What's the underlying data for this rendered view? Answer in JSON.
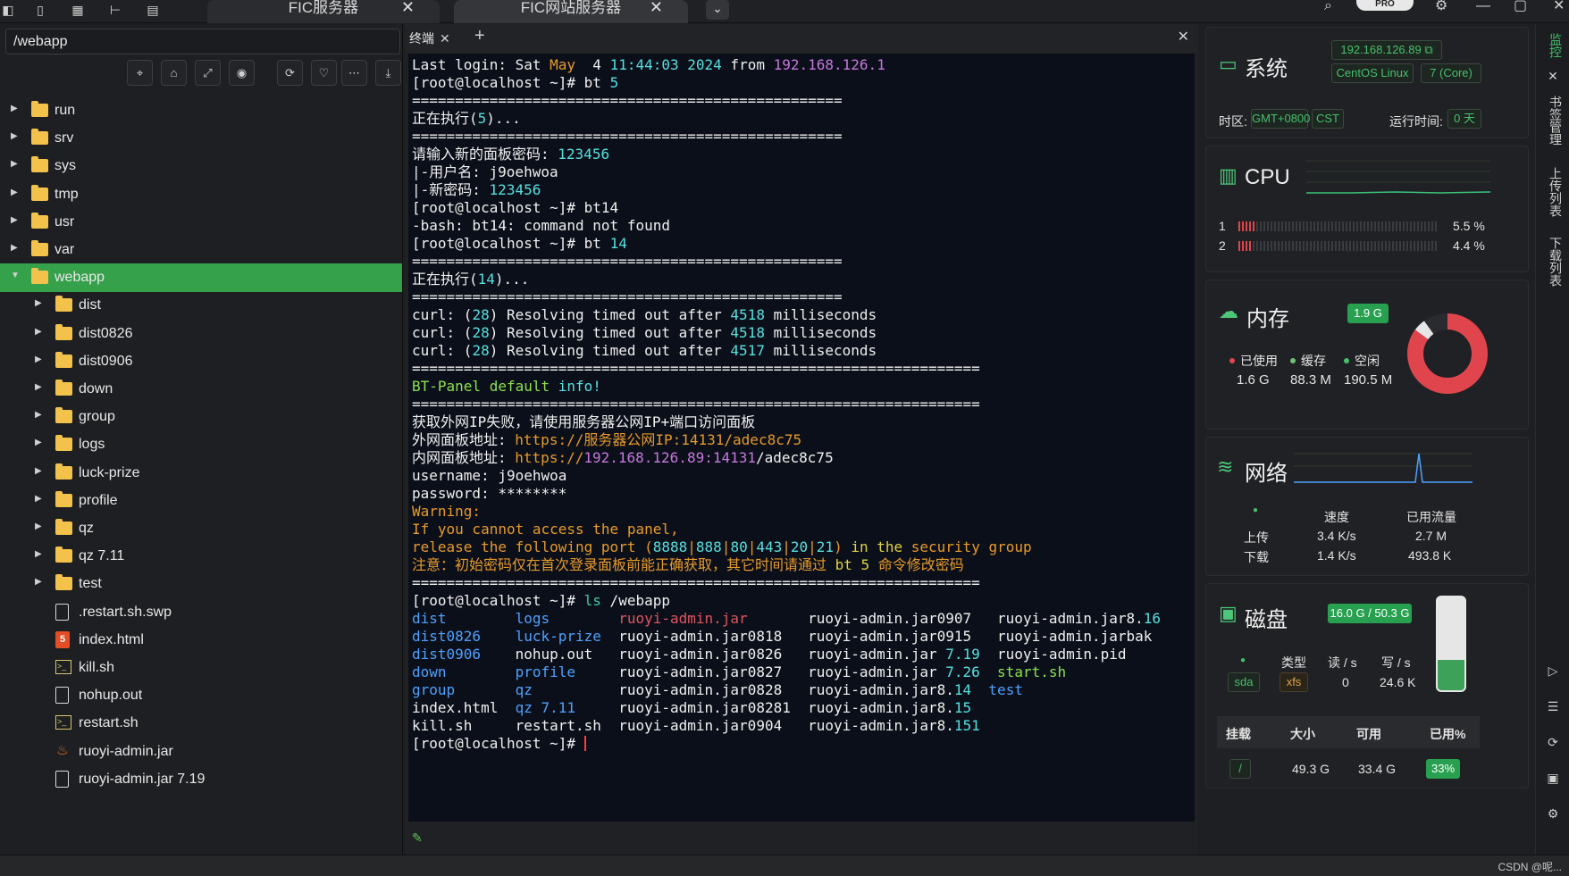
{
  "tabs": [
    {
      "label": "FIC服务器",
      "close": "✕"
    },
    {
      "label": "FIC网站服务器",
      "close": "✕"
    }
  ],
  "tab_dropdown": "⌄",
  "file_panel": {
    "path": "/webapp",
    "toolbar": [
      "⌖",
      "⌂",
      "⤢",
      "◉",
      "⟳",
      "♡",
      "⋯",
      "⤓"
    ],
    "items": [
      {
        "name": "run",
        "type": "folder",
        "indent": 0
      },
      {
        "name": "srv",
        "type": "folder",
        "indent": 0
      },
      {
        "name": "sys",
        "type": "folder",
        "indent": 0
      },
      {
        "name": "tmp",
        "type": "folder",
        "indent": 0
      },
      {
        "name": "usr",
        "type": "folder",
        "indent": 0
      },
      {
        "name": "var",
        "type": "folder",
        "indent": 0
      },
      {
        "name": "webapp",
        "type": "folder",
        "indent": 0,
        "expanded": true,
        "selected": true
      },
      {
        "name": "dist",
        "type": "folder",
        "indent": 1
      },
      {
        "name": "dist0826",
        "type": "folder",
        "indent": 1
      },
      {
        "name": "dist0906",
        "type": "folder",
        "indent": 1
      },
      {
        "name": "down",
        "type": "folder",
        "indent": 1
      },
      {
        "name": "group",
        "type": "folder",
        "indent": 1
      },
      {
        "name": "logs",
        "type": "folder",
        "indent": 1
      },
      {
        "name": "luck-prize",
        "type": "folder",
        "indent": 1
      },
      {
        "name": "profile",
        "type": "folder",
        "indent": 1
      },
      {
        "name": "qz",
        "type": "folder",
        "indent": 1
      },
      {
        "name": "qz 7.11",
        "type": "folder",
        "indent": 1
      },
      {
        "name": "test",
        "type": "folder",
        "indent": 1
      },
      {
        "name": ".restart.sh.swp",
        "type": "file",
        "indent": 1
      },
      {
        "name": "index.html",
        "type": "html",
        "indent": 1
      },
      {
        "name": "kill.sh",
        "type": "shell",
        "indent": 1
      },
      {
        "name": "nohup.out",
        "type": "file",
        "indent": 1
      },
      {
        "name": "restart.sh",
        "type": "shell",
        "indent": 1
      },
      {
        "name": "ruoyi-admin.jar",
        "type": "jar",
        "indent": 1
      },
      {
        "name": "ruoyi-admin.jar 7.19",
        "type": "file",
        "indent": 1
      }
    ]
  },
  "terminal": {
    "tab_label": "终端",
    "tab_close": "✕",
    "add": "+",
    "close": "✕",
    "lines": [
      [
        [
          "Last login: Sat ",
          ""
        ],
        [
          "May",
          "c-orange"
        ],
        [
          "  4 ",
          ""
        ],
        [
          "11:44:03 2024",
          "c-cyan"
        ],
        [
          " from ",
          ""
        ],
        [
          "192.168.126.1",
          "c-purple"
        ]
      ],
      [
        [
          "[root@localhost ~]# bt ",
          ""
        ],
        [
          "5",
          "c-cyan"
        ]
      ],
      [
        [
          "==================================================",
          ""
        ]
      ],
      [
        [
          "正在执行(",
          ""
        ],
        [
          "5",
          "c-cyan"
        ],
        [
          ")...",
          ""
        ]
      ],
      [
        [
          "==================================================",
          ""
        ]
      ],
      [
        [
          "请输入新的面板密码: ",
          ""
        ],
        [
          "123456",
          "c-cyan"
        ]
      ],
      [
        [
          "|-用户名: j9oehwoa",
          ""
        ]
      ],
      [
        [
          "|-新密码: ",
          ""
        ],
        [
          "123456",
          "c-cyan"
        ]
      ],
      [
        [
          "[root@localhost ~]# bt14",
          ""
        ]
      ],
      [
        [
          "-bash: bt14: command not found",
          ""
        ]
      ],
      [
        [
          "[root@localhost ~]# bt ",
          ""
        ],
        [
          "14",
          "c-cyan"
        ]
      ],
      [
        [
          "==================================================",
          ""
        ]
      ],
      [
        [
          "正在执行(",
          ""
        ],
        [
          "14",
          "c-cyan"
        ],
        [
          ")...",
          ""
        ]
      ],
      [
        [
          "==================================================",
          ""
        ]
      ],
      [
        [
          "curl: (",
          ""
        ],
        [
          "28",
          "c-cyan"
        ],
        [
          ") Resolving timed out after ",
          ""
        ],
        [
          "4518",
          "c-cyan"
        ],
        [
          " milliseconds",
          ""
        ]
      ],
      [
        [
          "curl: (",
          ""
        ],
        [
          "28",
          "c-cyan"
        ],
        [
          ") Resolving timed out after ",
          ""
        ],
        [
          "4518",
          "c-cyan"
        ],
        [
          " milliseconds",
          ""
        ]
      ],
      [
        [
          "curl: (",
          ""
        ],
        [
          "28",
          "c-cyan"
        ],
        [
          ") Resolving timed out after ",
          ""
        ],
        [
          "4517",
          "c-cyan"
        ],
        [
          " milliseconds",
          ""
        ]
      ],
      [
        [
          "==================================================================",
          ""
        ]
      ],
      [
        [
          "BT-Panel default ",
          "c-green"
        ],
        [
          "info!",
          "c-cyan"
        ]
      ],
      [
        [
          "==================================================================",
          ""
        ]
      ],
      [
        [
          "获取外网IP失败，请使用服务器公网IP+端口访问面板",
          ""
        ]
      ],
      [
        [
          "外网面板地址: ",
          ""
        ],
        [
          "https://服务器公网IP:14131/adec8c75",
          "c-orange"
        ]
      ],
      [
        [
          "内网面板地址: ",
          ""
        ],
        [
          "https://",
          "c-orange"
        ],
        [
          "192.168.126.89:14131",
          "c-purple"
        ],
        [
          "/adec8c75",
          ""
        ]
      ],
      [
        [
          "username: j9oehwoa",
          ""
        ]
      ],
      [
        [
          "password: ********",
          ""
        ]
      ],
      [
        [
          "Warning:",
          "c-orange"
        ]
      ],
      [
        [
          "If you cannot access the panel,",
          "c-orange"
        ]
      ],
      [
        [
          "release the following port (",
          "c-orange"
        ],
        [
          "8888",
          "c-cyan"
        ],
        [
          "|",
          "c-orange"
        ],
        [
          "888",
          "c-cyan"
        ],
        [
          "|",
          "c-orange"
        ],
        [
          "80",
          "c-cyan"
        ],
        [
          "|",
          "c-orange"
        ],
        [
          "443",
          "c-cyan"
        ],
        [
          "|",
          "c-orange"
        ],
        [
          "20",
          "c-cyan"
        ],
        [
          "|",
          "c-orange"
        ],
        [
          "21",
          "c-cyan"
        ],
        [
          ") ",
          "c-orange"
        ],
        [
          "in the",
          "c-yellow"
        ],
        [
          " security group",
          "c-orange"
        ]
      ],
      [
        [
          "注意：初始密码仅在首次登录面板前能正确获取，其它时间请通过 ",
          "c-orange"
        ],
        [
          "bt 5",
          "c-yellow"
        ],
        [
          " 命令修改密码",
          "c-orange"
        ]
      ],
      [
        [
          "==================================================================",
          ""
        ]
      ],
      [
        [
          "[root@localhost ~]# ",
          ""
        ],
        [
          "ls",
          "c-teal"
        ],
        [
          " /webapp",
          ""
        ]
      ],
      [
        [
          "dist",
          "c-blue"
        ],
        [
          "        ",
          ""
        ],
        [
          "logs",
          "c-blue"
        ],
        [
          "        ",
          ""
        ],
        [
          "ruoyi-admin.jar",
          "c-red"
        ],
        [
          "       ruoyi-admin.jar0907   ruoyi-admin.jar8.",
          ""
        ],
        [
          "16",
          "c-cyan"
        ]
      ],
      [
        [
          "dist0826",
          "c-blue"
        ],
        [
          "    ",
          ""
        ],
        [
          "luck-prize",
          "c-blue"
        ],
        [
          "  ruoyi-admin.jar0818   ruoyi-admin.jar0915   ruoyi-admin.jarbak",
          ""
        ]
      ],
      [
        [
          "dist0906",
          "c-blue"
        ],
        [
          "    nohup.out   ruoyi-admin.jar0826   ruoyi-admin.jar ",
          ""
        ],
        [
          "7.19",
          "c-cyan"
        ],
        [
          "  ruoyi-admin.pid",
          ""
        ]
      ],
      [
        [
          "down",
          "c-blue"
        ],
        [
          "        ",
          ""
        ],
        [
          "profile",
          "c-blue"
        ],
        [
          "     ruoyi-admin.jar0827   ruoyi-admin.jar ",
          ""
        ],
        [
          "7.26",
          "c-cyan"
        ],
        [
          "  ",
          ""
        ],
        [
          "start.sh",
          "c-green"
        ]
      ],
      [
        [
          "group",
          "c-blue"
        ],
        [
          "       ",
          ""
        ],
        [
          "qz",
          "c-blue"
        ],
        [
          "          ruoyi-admin.jar0828   ruoyi-admin.jar8.",
          ""
        ],
        [
          "14",
          "c-cyan"
        ],
        [
          "  ",
          ""
        ],
        [
          "test",
          "c-blue"
        ]
      ],
      [
        [
          "index.html  ",
          ""
        ],
        [
          "qz 7.11",
          "c-blue"
        ],
        [
          "     ruoyi-admin.jar08281  ruoyi-admin.jar8.",
          ""
        ],
        [
          "15",
          "c-cyan"
        ]
      ],
      [
        [
          "kill.sh     restart.sh  ruoyi-admin.jar0904   ruoyi-admin.jar8.",
          ""
        ],
        [
          "151",
          "c-cyan"
        ]
      ],
      [
        [
          "[root@localhost ~]# ",
          ""
        ]
      ]
    ]
  },
  "system": {
    "title": "系统",
    "ip": "192.168.126.89",
    "os": "CentOS Linux",
    "version": "7 (Core)",
    "tz_label": "时区:",
    "tz": "GMT+0800",
    "tz_name": "CST",
    "uptime_label": "运行时间:",
    "uptime": "0 天"
  },
  "cpu": {
    "title": "CPU",
    "cores": [
      {
        "id": "1",
        "percent": 5.5,
        "label": "5.5 %"
      },
      {
        "id": "2",
        "percent": 4.4,
        "label": "4.4 %"
      }
    ]
  },
  "memory": {
    "title": "内存",
    "total": "1.9 G",
    "used_label": "已使用",
    "used": "1.6 G",
    "cache_label": "缓存",
    "cache": "88.3 M",
    "free_label": "空闲",
    "free": "190.5 M",
    "used_fraction": 0.85,
    "cache_fraction": 0.05
  },
  "network": {
    "title": "网络",
    "speed_header": "速度",
    "traffic_header": "已用流量",
    "up_label": "上传",
    "up_speed": "3.4 K/s",
    "up_total": "2.7 M",
    "down_label": "下载",
    "down_speed": "1.4 K/s",
    "down_total": "493.8 K"
  },
  "disk": {
    "title": "磁盘",
    "usage": "16.0 G / 50.3 G",
    "type_header": "类型",
    "read_header": "读 / s",
    "write_header": "写 / s",
    "device": "sda",
    "fs": "xfs",
    "read": "0",
    "write": "24.6 K",
    "fill_fraction": 0.33,
    "table_headers": [
      "挂载",
      "大小",
      "可用",
      "已用%"
    ],
    "mount": "/",
    "size": "49.3 G",
    "avail": "33.4 G",
    "used_pct": "33%"
  },
  "right_strip": {
    "labels": [
      "监控",
      "书签管理",
      "上传列表",
      "下载列表"
    ]
  },
  "watermark": "CSDN @呢..."
}
